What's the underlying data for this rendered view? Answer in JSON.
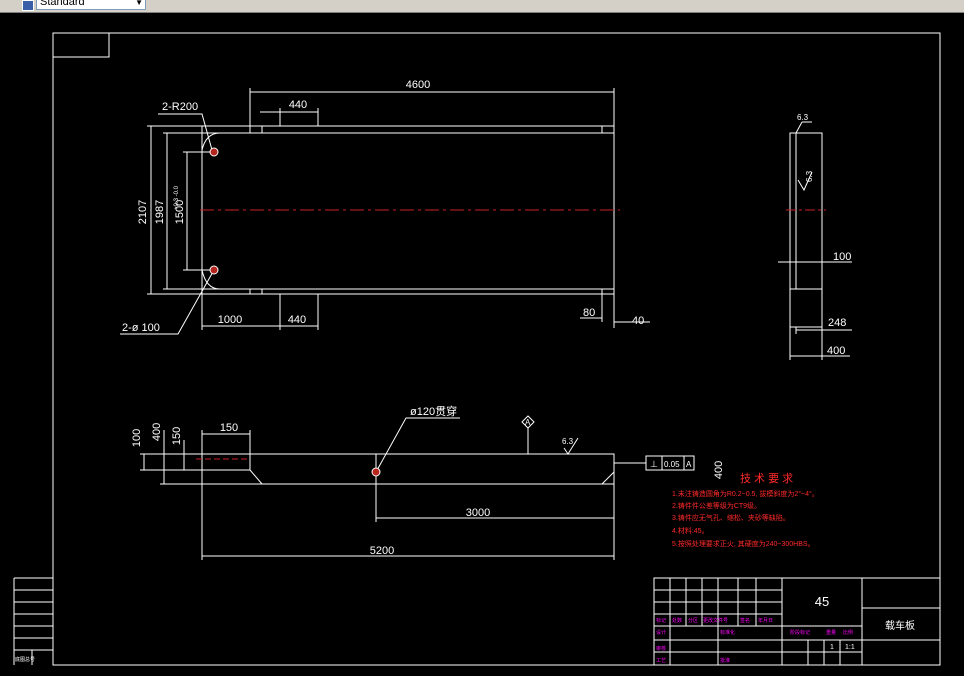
{
  "toolbar": {
    "style_select": "Standard"
  },
  "colors": {
    "background": "#000000",
    "geometry": "#ffffff",
    "centerline": "#c8202a",
    "notes": "#ff2a2a",
    "titleblock_text": "#ff00ff"
  },
  "top_view": {
    "dims": {
      "length": "4600",
      "slot": "440",
      "r_label": "2-R200",
      "h_total": "2107",
      "h_inner": "1987",
      "h_holes": "1500",
      "tol": "+0.3 -0.0",
      "left": "1000",
      "slot_bottom": "440",
      "hole_label": "2-ø 100",
      "gap_a": "80",
      "gap_b": "40"
    }
  },
  "side_view": {
    "rough": "6.3",
    "rough2": "6.3",
    "d100": "100",
    "d248": "248",
    "d400": "400"
  },
  "front_view": {
    "d100": "100",
    "d400": "400",
    "d150": "150",
    "d150b": "150",
    "hole": "ø120贯穿",
    "datum": "A",
    "rough": "6.3",
    "tol_sym": "⊥",
    "tol_val": "0.05",
    "tol_ref": "A",
    "d3000": "3000",
    "d5200": "5200",
    "d400v": "400"
  },
  "notes": {
    "title": "技 术 要 求",
    "items": [
      "1.未注铸造圆角为R0.2~0.5, 拔模斜度为2°~4°。",
      "2.铸件件公差等级为CT9级。",
      "3.铸件应无气孔、缩松、夹砂等缺陷。",
      "4.材料:45。",
      "5.按照处理要求正火, 其硬度为240~300HBS。"
    ]
  },
  "title_block": {
    "material": "45",
    "part_name": "载车板",
    "row_labels": [
      "标记",
      "处数",
      "分区",
      "更改文件号",
      "签名",
      "年月日"
    ],
    "design": "设计",
    "std": "标准化",
    "audit": "审核",
    "process": "工艺",
    "approve": "批准",
    "stage": "阶段标记",
    "weight": "重量",
    "scale": "比例",
    "qty": "1",
    "ratio": "1:1"
  },
  "left_strip": {
    "label": "底图总号"
  }
}
